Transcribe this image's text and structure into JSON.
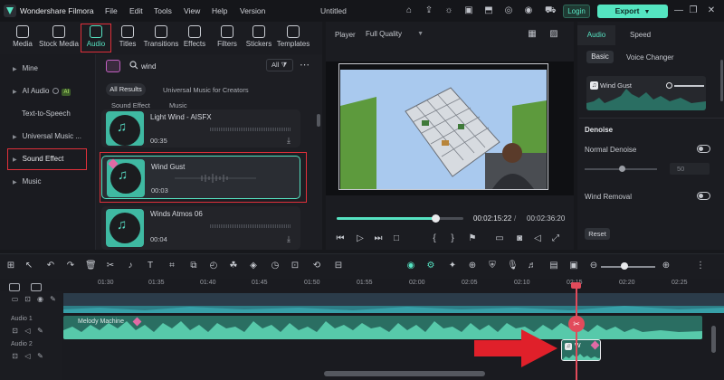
{
  "app": {
    "name": "Wondershare Filmora",
    "doc_title": "Untitled"
  },
  "menu": [
    "File",
    "Edit",
    "Tools",
    "View",
    "Help",
    "Version"
  ],
  "header": {
    "login_label": "Login",
    "export_label": "Export"
  },
  "media_toolbar": [
    {
      "label": "Media",
      "icon": "media-icon"
    },
    {
      "label": "Stock Media",
      "icon": "stock-media-icon"
    },
    {
      "label": "Audio",
      "icon": "audio-icon",
      "active": true
    },
    {
      "label": "Titles",
      "icon": "titles-icon"
    },
    {
      "label": "Transitions",
      "icon": "transitions-icon"
    },
    {
      "label": "Effects",
      "icon": "effects-icon"
    },
    {
      "label": "Filters",
      "icon": "filters-icon"
    },
    {
      "label": "Stickers",
      "icon": "stickers-icon"
    },
    {
      "label": "Templates",
      "icon": "templates-icon"
    }
  ],
  "left_nav": [
    {
      "label": "Mine"
    },
    {
      "label": "AI Audio",
      "badge": "AI"
    },
    {
      "label": "Text-to-Speech"
    },
    {
      "label": "Universal Music ..."
    },
    {
      "label": "Sound Effect",
      "active": true
    },
    {
      "label": "Music"
    }
  ],
  "search": {
    "value": "wind",
    "filter_label": "All"
  },
  "result_tabs": {
    "all": "All Results",
    "universal": "Universal Music for Creators"
  },
  "columns": {
    "sound_effect": "Sound Effect",
    "music": "Music"
  },
  "audio_items": [
    {
      "name": "Light Wind - AISFX",
      "duration": "00:35"
    },
    {
      "name": "Wind Gust",
      "duration": "00:03",
      "selected": true
    },
    {
      "name": "Winds Atmos 06",
      "duration": "00:04"
    }
  ],
  "player": {
    "label": "Player",
    "quality": "Full Quality",
    "current_time": "00:02:15:22",
    "separator": "/",
    "total_time": "00:02:36:20",
    "progress": 0.78
  },
  "properties": {
    "tabs": [
      "Audio",
      "Speed"
    ],
    "subtabs": [
      "Basic",
      "Voice Changer"
    ],
    "clip_name": "Wind Gust",
    "denoise_title": "Denoise",
    "normal_denoise_label": "Normal Denoise",
    "denoise_value": "50",
    "wind_removal_label": "Wind Removal",
    "reset_label": "Reset"
  },
  "timeline": {
    "ticks": [
      "01:30",
      "01:35",
      "01:40",
      "01:45",
      "01:50",
      "01:55",
      "02:00",
      "02:05",
      "02:10",
      "02:15",
      "02:20",
      "02:25"
    ],
    "tracks": [
      {
        "label": "Audio 1",
        "clip": "Melody Machine"
      },
      {
        "label": "Audio 2",
        "clip": "W"
      }
    ]
  },
  "colors": {
    "accent": "#56e3c2",
    "highlight": "#e0303a",
    "playhead": "#e24b5b",
    "clip": "#2a6e62"
  }
}
